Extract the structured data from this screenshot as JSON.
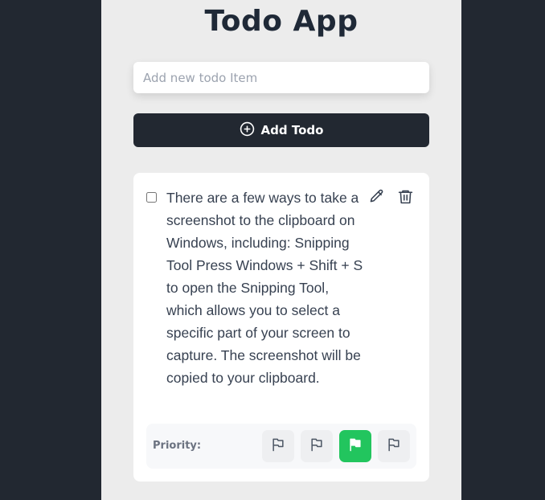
{
  "header": {
    "title": "Todo App"
  },
  "new_todo": {
    "value": "",
    "placeholder": "Add new todo Item",
    "add_button_label": "Add Todo",
    "add_icon": "plus-circle-icon"
  },
  "todos": [
    {
      "checked": false,
      "text": "There are a few ways to take a screenshot to the clipboard on Windows, including: Snipping Tool Press Windows + Shift + S to open the Snipping Tool, which allows you to select a specific part of your screen to capture. The screenshot will be copied to your clipboard.",
      "edit_icon": "pencil-icon",
      "delete_icon": "trash-icon",
      "priority_label": "Priority:",
      "priority_levels": 4,
      "selected_priority": 3,
      "priority_icon": "flag-icon"
    }
  ],
  "colors": {
    "background": "#222831",
    "panel": "#ececec",
    "button": "#222831",
    "selected_priority": "#22c55e",
    "text": "#374151"
  }
}
